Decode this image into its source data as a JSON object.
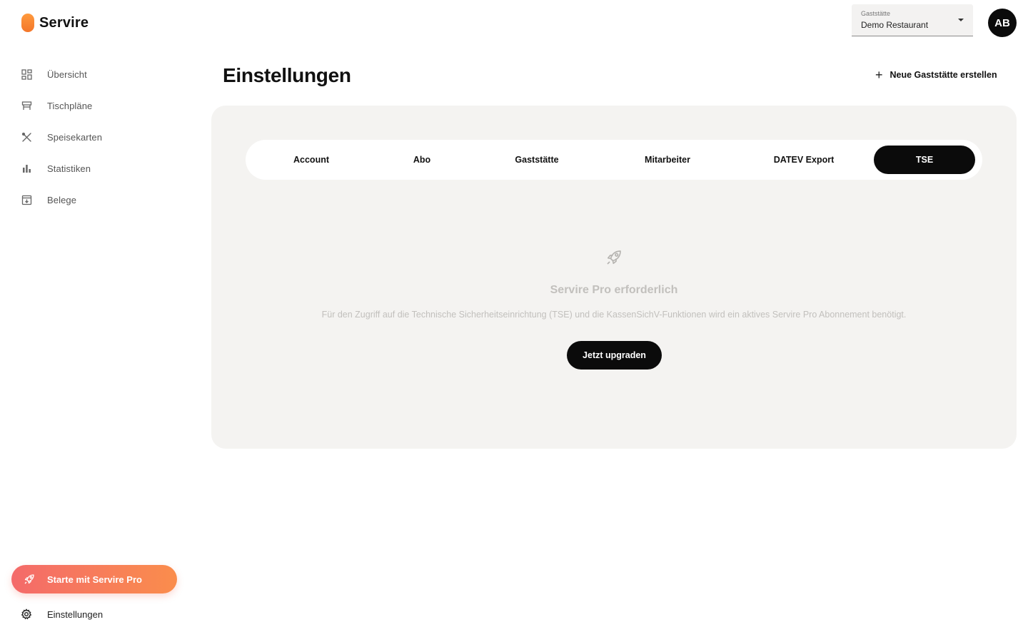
{
  "brand": {
    "name": "Servire",
    "accent": "#f3762a"
  },
  "sidebar": {
    "items": [
      {
        "label": "Übersicht",
        "icon": "dashboard-grid-icon"
      },
      {
        "label": "Tischpläne",
        "icon": "table-icon"
      },
      {
        "label": "Speisekarten",
        "icon": "cutlery-icon"
      },
      {
        "label": "Statistiken",
        "icon": "bar-chart-icon"
      },
      {
        "label": "Belege",
        "icon": "receipt-archive-icon"
      }
    ],
    "pro_button": {
      "label": "Starte mit Servire Pro",
      "icon": "rocket-icon"
    },
    "settings": {
      "label": "Einstellungen",
      "icon": "gear-icon"
    }
  },
  "header": {
    "selector": {
      "caption": "Gaststätte",
      "value": "Demo Restaurant",
      "icon": "caret-down-icon"
    },
    "avatar_initials": "AB"
  },
  "main": {
    "title": "Einstellungen",
    "new_button": {
      "label": "Neue Gaststätte erstellen",
      "icon": "plus-icon"
    },
    "tabs": [
      {
        "label": "Account",
        "active": false
      },
      {
        "label": "Abo",
        "active": false
      },
      {
        "label": "Gaststätte",
        "active": false
      },
      {
        "label": "Mitarbeiter",
        "active": false
      },
      {
        "label": "DATEV Export",
        "active": false
      },
      {
        "label": "TSE",
        "active": true
      }
    ],
    "empty_state": {
      "icon": "rocket-icon",
      "title": "Servire Pro erforderlich",
      "description": "Für den Zugriff auf die Technische Sicherheitseinrichtung (TSE) und die KassenSichV-Funktionen wird ein aktives Servire Pro Abonnement benötigt.",
      "button_label": "Jetzt upgraden"
    }
  }
}
